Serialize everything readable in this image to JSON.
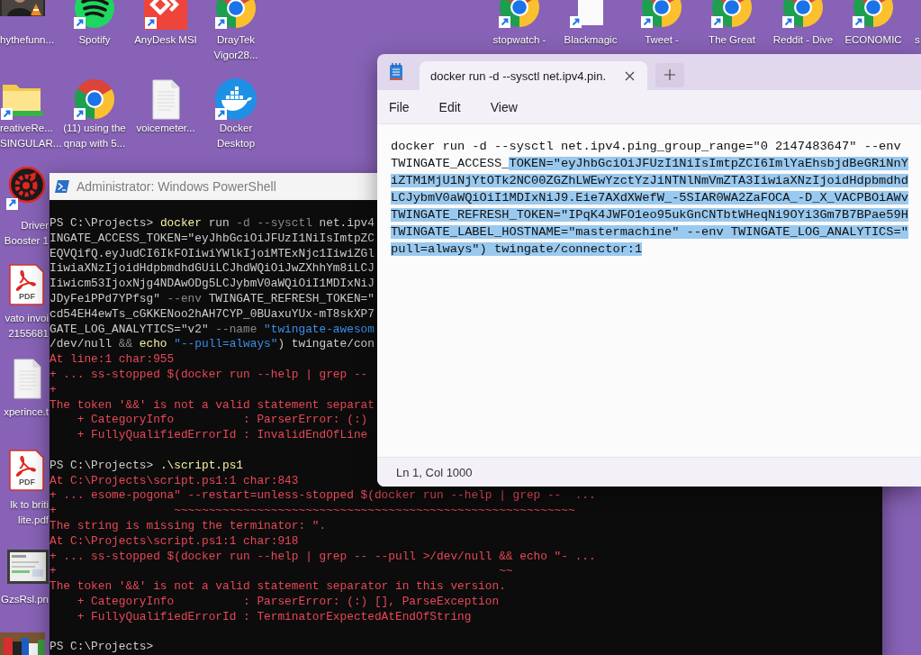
{
  "desktop": {
    "icons": [
      {
        "kind": "video",
        "lines": [
          "hythefunn..."
        ]
      },
      {
        "kind": "music",
        "lines": [
          "Spotify"
        ]
      },
      {
        "kind": "remote",
        "lines": [
          "AnyDesk MSI"
        ]
      },
      {
        "kind": "browser",
        "lines": [
          "DrayTek",
          "Vigor28..."
        ]
      },
      {
        "kind": "browser",
        "lines": [
          "stopwatch -"
        ]
      },
      {
        "kind": "blank",
        "lines": [
          "Blackmagic"
        ]
      },
      {
        "kind": "browser",
        "lines": [
          "Tweet -"
        ]
      },
      {
        "kind": "browser",
        "lines": [
          "The Great"
        ]
      },
      {
        "kind": "browser",
        "lines": [
          "Reddit - Dive"
        ]
      },
      {
        "kind": "browser",
        "lines": [
          "ECONOMIC"
        ]
      },
      {
        "kind": "label",
        "lines": [
          "s"
        ]
      },
      {
        "kind": "folder",
        "lines": [
          "reativeRe...",
          "SINGULAR..."
        ]
      },
      {
        "kind": "browser",
        "lines": [
          "(11) using the",
          "qnap with 5..."
        ]
      },
      {
        "kind": "document",
        "lines": [
          "voicemeter..."
        ]
      },
      {
        "kind": "container",
        "lines": [
          "Docker",
          "Desktop"
        ]
      },
      {
        "kind": "booster",
        "lines": [
          "Driver",
          "Booster 1"
        ]
      },
      {
        "kind": "pdf",
        "badge": "PDF",
        "lines": [
          "vato invoi",
          "2155681"
        ]
      },
      {
        "kind": "document",
        "lines": [
          "xperince.t"
        ]
      },
      {
        "kind": "pdf",
        "badge": "PDF",
        "lines": [
          "lk to briti",
          "lite.pdf"
        ]
      },
      {
        "lines": [
          "GzsRsl.pn"
        ]
      },
      {
        "kind": "blocks"
      }
    ]
  },
  "powershell": {
    "title": "Administrator: Windows PowerShell",
    "lines": [
      {
        "kind": "input",
        "segments": [
          {
            "kind": "plain",
            "text": "PS C:\\Projects> "
          },
          {
            "kind": "command",
            "text": "docker"
          },
          {
            "kind": "plain",
            "text": " run "
          },
          {
            "kind": "parameter",
            "text": "-d --sysctl"
          },
          {
            "kind": "plain",
            "text": " net.ipv4"
          }
        ]
      },
      {
        "kind": "input",
        "segments": [
          {
            "kind": "plain",
            "text": "INGATE_ACCESS_TOKEN=\"eyJhbGciOiJFUzI1NiIsImtpZC"
          }
        ]
      },
      {
        "kind": "input",
        "segments": [
          {
            "kind": "plain",
            "text": "EQVQifQ.eyJudCI6IkFOIiwiYWlkIjoiMTExNjc1IiwiZGl"
          }
        ]
      },
      {
        "kind": "input",
        "segments": [
          {
            "kind": "plain",
            "text": "IiwiaXNzIjoidHdpbmdhdGUiLCJhdWQiOiJwZXhhYm8iLCJ"
          }
        ]
      },
      {
        "kind": "input",
        "segments": [
          {
            "kind": "plain",
            "text": "Iiwicm53IjoxNjg4NDAwODg5LCJybmV0aWQiOiI1MDIxNiJ"
          }
        ]
      },
      {
        "kind": "input",
        "segments": [
          {
            "kind": "plain",
            "text": "JDyFeiPPd7YPfsg\" "
          },
          {
            "kind": "parameter",
            "text": "--env"
          },
          {
            "kind": "plain",
            "text": " TWINGATE_REFRESH_TOKEN=\""
          }
        ]
      },
      {
        "kind": "input",
        "segments": [
          {
            "kind": "plain",
            "text": "cd54EH4ewTs_cGKKENoo2hAH7CYP_0BUaxuYUx-mT8skXP7"
          }
        ]
      },
      {
        "kind": "input",
        "segments": [
          {
            "kind": "plain",
            "text": "GATE_LOG_ANALYTICS=\"v2\" "
          },
          {
            "kind": "parameter",
            "text": "--name"
          },
          {
            "kind": "string",
            "text": " \"twingate-awesom"
          }
        ]
      },
      {
        "kind": "input",
        "segments": [
          {
            "kind": "plain",
            "text": "/dev/null "
          },
          {
            "kind": "parameter",
            "text": "&&"
          },
          {
            "kind": "command",
            "text": " echo"
          },
          {
            "kind": "string",
            "text": " \"--pull=always\""
          },
          {
            "kind": "plain",
            "text": ") twingate/con"
          }
        ]
      },
      {
        "kind": "error",
        "text": "At line:1 char:955"
      },
      {
        "kind": "error",
        "text": "+ ... ss-stopped $(docker run --help | grep --"
      },
      {
        "kind": "error",
        "text": "+"
      },
      {
        "kind": "error",
        "text": "The token '&&' is not a valid statement separat"
      },
      {
        "kind": "error",
        "text": "    + CategoryInfo          : ParserError: (:)"
      },
      {
        "kind": "error",
        "text": "    + FullyQualifiedErrorId : InvalidEndOfLine"
      },
      {
        "kind": "blank"
      },
      {
        "kind": "input",
        "segments": [
          {
            "kind": "plain",
            "text": "PS C:\\Projects> "
          },
          {
            "kind": "command",
            "text": ".\\script.ps1"
          }
        ]
      },
      {
        "kind": "error",
        "text": "At C:\\Projects\\script.ps1:1 char:843"
      },
      {
        "kind": "error",
        "text": "+ ... esome-pogona\" --restart=unless-stopped $(docker run --help | grep --  ..."
      },
      {
        "kind": "error",
        "text": "+                 ~~~~~~~~~~~~~~~~~~~~~~~~~~~~~~~~~~~~~~~~~~~~~~~~~~~~~~~~~~"
      },
      {
        "kind": "error",
        "text": "The string is missing the terminator: \"."
      },
      {
        "kind": "error",
        "text": "At C:\\Projects\\script.ps1:1 char:918"
      },
      {
        "kind": "error",
        "text": "+ ... ss-stopped $(docker run --help | grep -- --pull >/dev/null && echo \"- ..."
      },
      {
        "kind": "error",
        "text": "+                                                                ~~"
      },
      {
        "kind": "error",
        "text": "The token '&&' is not a valid statement separator in this version."
      },
      {
        "kind": "error",
        "text": "    + CategoryInfo          : ParserError: (:) [], ParseException"
      },
      {
        "kind": "error",
        "text": "    + FullyQualifiedErrorId : TerminatorExpectedAtEndOfString"
      },
      {
        "kind": "blank"
      },
      {
        "kind": "input",
        "segments": [
          {
            "kind": "plain",
            "text": "PS C:\\Projects>"
          }
        ]
      }
    ]
  },
  "notepad": {
    "tabs": [
      {
        "label": "docker run -d --sysctl net.ipv4.pin.",
        "selected": true
      }
    ],
    "menu": [
      "File",
      "Edit",
      "View"
    ],
    "lines": [
      {
        "segments": [
          {
            "text": "docker run -d --sysctl net.ipv4.ping_group_range=\"0 2147483647\" --env",
            "selected": false
          }
        ]
      },
      {
        "segments": [
          {
            "text": "TWINGATE_ACCESS_",
            "selected": false
          },
          {
            "text": "TOKEN=\"eyJhbGciOiJFUzI1NiIsImtpZCI6ImlYaEhsbjdBeGRiNnY",
            "selected": true
          }
        ]
      },
      {
        "segments": [
          {
            "text": "iZTM1MjU1NjYtOTk2NC00ZGZhLWEwYzctYzJiNTNlNmVmZTA3IiwiaXNzIjoidHdpbmdhd",
            "selected": true
          }
        ]
      },
      {
        "segments": [
          {
            "text": "LCJybmV0aWQiOiI1MDIxNiJ9.Eie7AXdXWefW_-5SIAR0WA2ZaFOCA_-D_X_VACPBOiAWv",
            "selected": true
          }
        ]
      },
      {
        "segments": [
          {
            "text": "TWINGATE_REFRESH_TOKEN=\"IPqK4JWFO1eo95ukGnCNTbtWHeqNi9OYi3Gm7B7BPae59H",
            "selected": true
          }
        ]
      },
      {
        "segments": [
          {
            "text": "TWINGATE_LABEL_HOSTNAME=\"mastermachine\" --env TWINGATE_LOG_ANALYTICS=\"",
            "selected": true
          }
        ]
      },
      {
        "segments": [
          {
            "text": "pull=always\") twingate/connector:1",
            "selected": true
          }
        ]
      }
    ],
    "status": "Ln 1, Col 1000"
  }
}
